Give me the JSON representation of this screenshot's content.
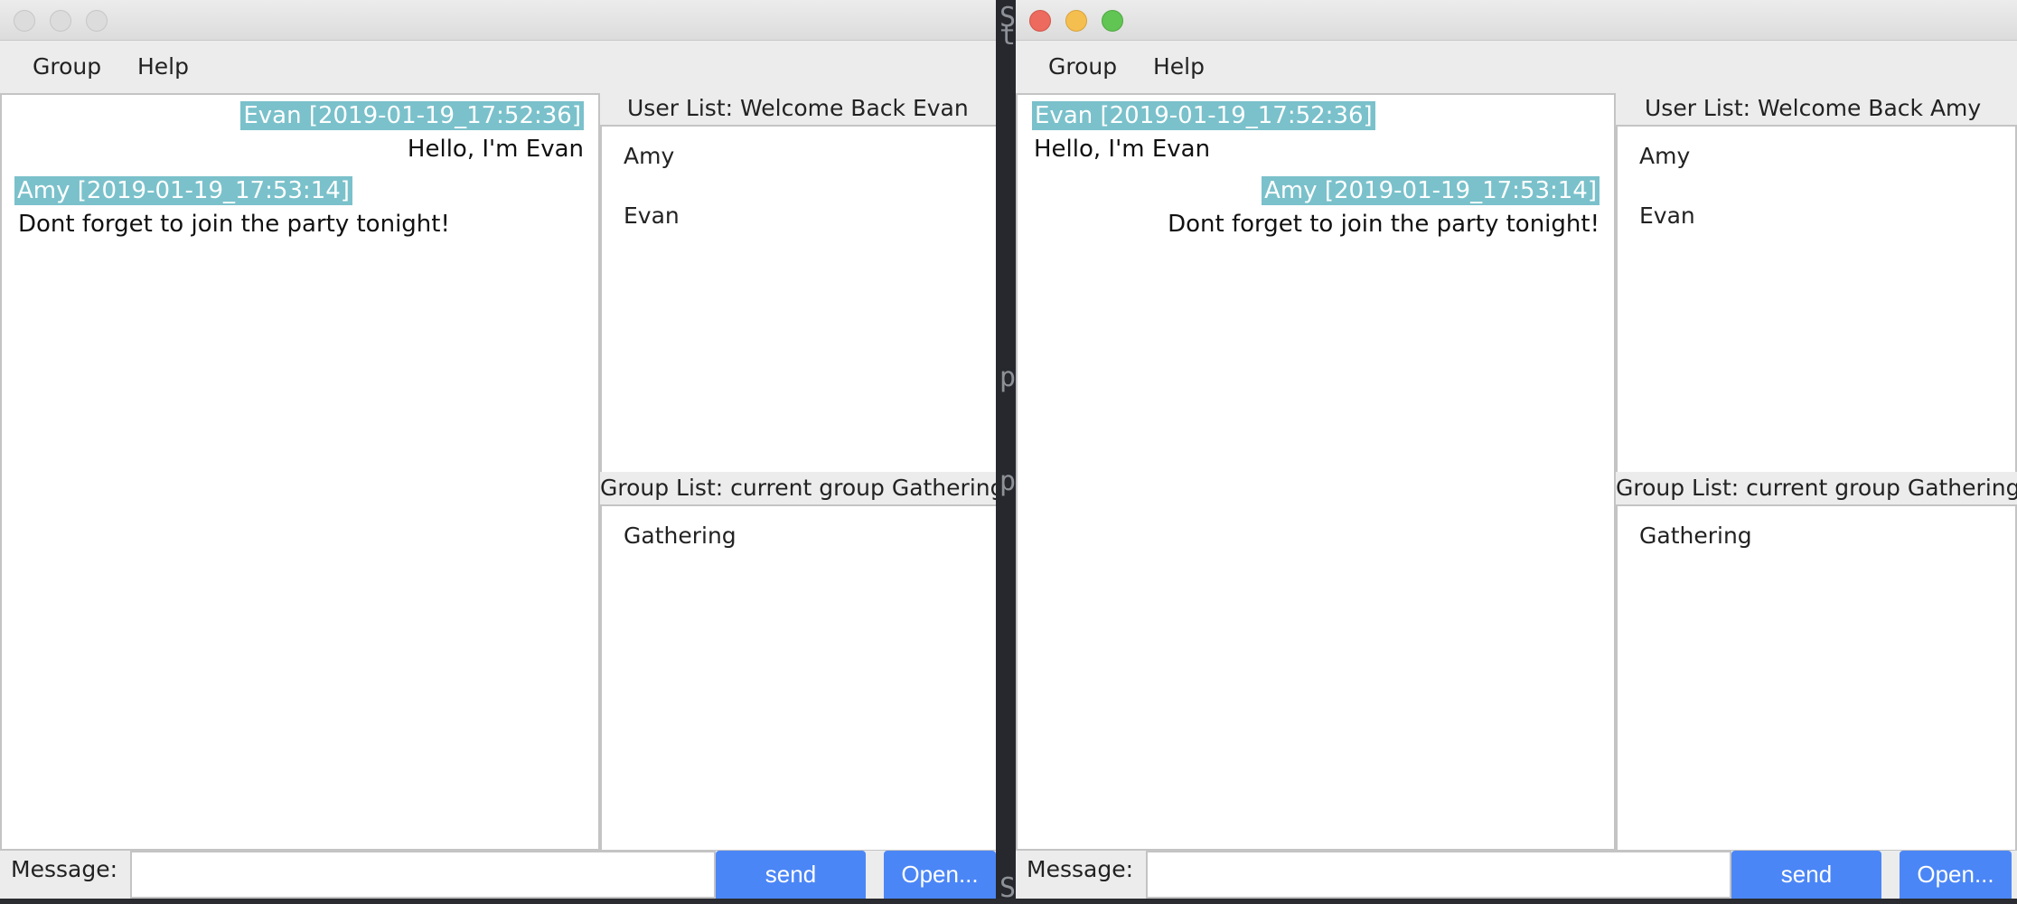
{
  "desktop": {
    "chars": [
      "S",
      "t",
      "p",
      "p",
      "S"
    ]
  },
  "windows": [
    {
      "id": "evan",
      "state": "inactive",
      "menu": [
        "Group",
        "Help"
      ],
      "messages": [
        {
          "header": "Evan [2019-01-19_17:52:36]",
          "text": "Hello, I'm Evan",
          "align": "right"
        },
        {
          "header": "Amy [2019-01-19_17:53:14]",
          "text": "Dont forget to join the party tonight!",
          "align": "left"
        }
      ],
      "user_list": {
        "title": "User List:  Welcome Back Evan",
        "users": [
          "Amy",
          "Evan"
        ]
      },
      "group_list": {
        "title": "Group List: current group Gathering",
        "groups": [
          "Gathering"
        ]
      },
      "composer": {
        "label": "Message:",
        "value": "",
        "send_label": "send",
        "open_label": "Open..."
      }
    },
    {
      "id": "amy",
      "state": "active",
      "menu": [
        "Group",
        "Help"
      ],
      "messages": [
        {
          "header": "Evan [2019-01-19_17:52:36]",
          "text": "Hello, I'm Evan",
          "align": "left"
        },
        {
          "header": "Amy [2019-01-19_17:53:14]",
          "text": "Dont forget to join the party tonight!",
          "align": "right"
        }
      ],
      "user_list": {
        "title": "User List:  Welcome Back Amy",
        "users": [
          "Amy",
          "Evan"
        ]
      },
      "group_list": {
        "title": "Group List: current group Gathering",
        "groups": [
          "Gathering"
        ]
      },
      "composer": {
        "label": "Message:",
        "value": "",
        "send_label": "send",
        "open_label": "Open..."
      }
    }
  ],
  "colors": {
    "sender_highlight": "#7ac1cb",
    "button": "#4b86f6",
    "close": "#ed6a5e",
    "minimize": "#f5bf4f",
    "maximize": "#61c554"
  }
}
